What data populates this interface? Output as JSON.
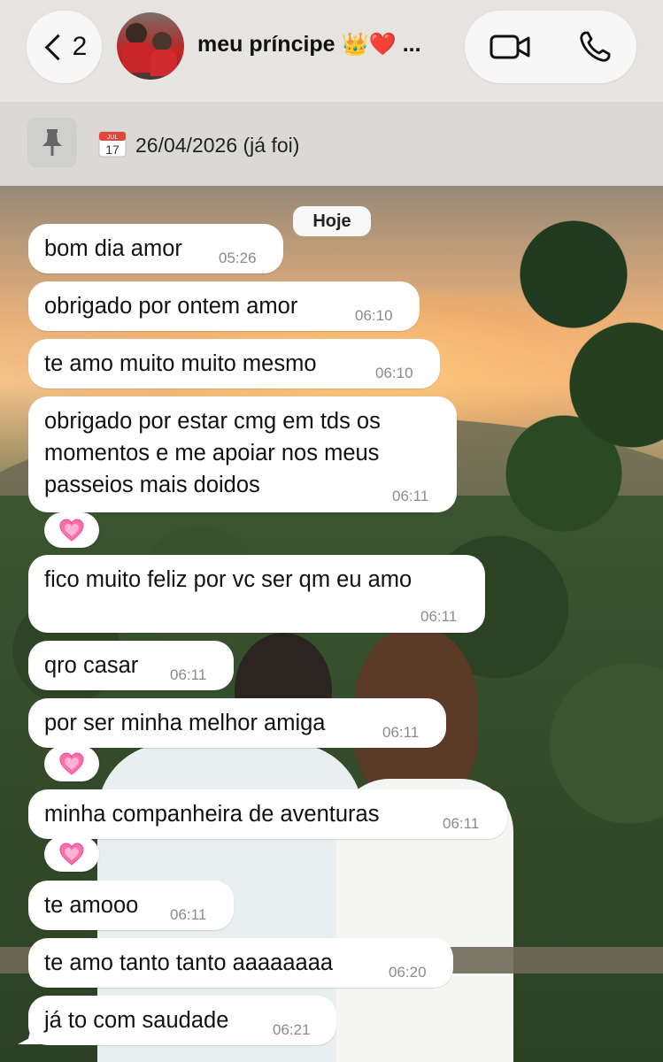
{
  "header": {
    "back_count": "2",
    "contact_name": "meu príncipe 👑❤️ ..."
  },
  "pinned": {
    "text": "26/04/2026 (já foi)"
  },
  "date_chip": "Hoje",
  "messages": [
    {
      "text": "bom dia amor",
      "time": "05:26"
    },
    {
      "text": "obrigado por ontem amor",
      "time": "06:10"
    },
    {
      "text": "te amo muito muito mesmo",
      "time": "06:10"
    },
    {
      "text": "obrigado por estar cmg em tds os momentos e me apoiar nos meus passeios mais doidos",
      "time": "06:11",
      "reaction": "💗"
    },
    {
      "text": "fico muito feliz por vc ser qm eu amo",
      "time": "06:11"
    },
    {
      "text": "qro casar",
      "time": "06:11"
    },
    {
      "text": "por ser minha melhor amiga",
      "time": "06:11",
      "reaction": "💗"
    },
    {
      "text": "minha companheira de aventuras",
      "time": "06:11",
      "reaction": "💗"
    },
    {
      "text": "te amooo",
      "time": "06:11"
    },
    {
      "text": "te amo tanto tanto aaaaaaaa",
      "time": "06:20"
    },
    {
      "text": "já to com saudade",
      "time": "06:21"
    }
  ],
  "icons": {
    "back": "chevron-left-icon",
    "video": "video-camera-icon",
    "phone": "phone-icon",
    "pin": "pin-icon",
    "calendar": "calendar-icon",
    "reaction": "pink-heart-emoji"
  },
  "colors": {
    "bubble": "#ffffff",
    "header": "#eceae8",
    "pinned_bar": "#dedddb",
    "time_text": "#8b8b8b"
  }
}
